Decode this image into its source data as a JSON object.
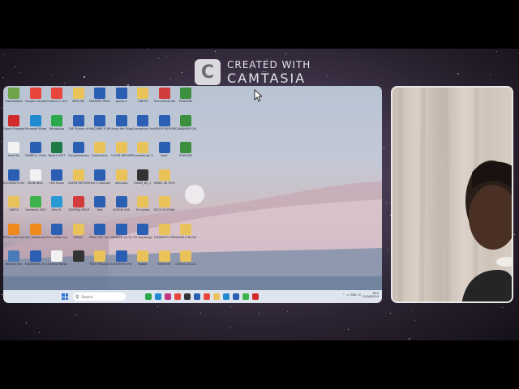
{
  "overlay": {
    "brand_line1": "CREATED WITH",
    "brand_line2": "CAMTASIA",
    "logo_letter": "C"
  },
  "desktop": {
    "icons": [
      {
        "label": "mandeladla",
        "color": "#6ea34a"
      },
      {
        "label": "Google Chrome",
        "color": "#e8453c"
      },
      {
        "label": "Chrome 2 Chrome",
        "color": "#e8453c"
      },
      {
        "label": "NEW 3B",
        "color": "#e9c25a"
      },
      {
        "label": "MISIMPO PROLI T",
        "color": "#2b5fb3"
      },
      {
        "label": "group 4",
        "color": "#2b5fb3"
      },
      {
        "label": "CNFSS",
        "color": "#e9c25a"
      },
      {
        "label": "Documents Methods",
        "color": "#d13b3b"
      },
      {
        "label": "PHAUNIE",
        "color": "#3c8f3c"
      },
      {
        "label": "Opera Browser",
        "color": "#d12a2a"
      },
      {
        "label": "Microsoft Edge",
        "color": "#1f8ad1"
      },
      {
        "label": "WhatsApp",
        "color": "#2aa84a"
      },
      {
        "label": "CNF Survey of a Studen",
        "color": "#2b5fb3"
      },
      {
        "label": "MACHINE FORMULA",
        "color": "#2b5fb3"
      },
      {
        "label": "Using the Diagnostic",
        "color": "#2b5fb3"
      },
      {
        "label": "Conceptual framework",
        "color": "#2b5fb3"
      },
      {
        "label": "KMSEP REPORT 1",
        "color": "#2b5fb3"
      },
      {
        "label": "CANAMAM DISHBOARD",
        "color": "#3c8f3c"
      },
      {
        "label": "text file",
        "color": "#f2f2f2"
      },
      {
        "label": "SUBBELL Cetex Hp",
        "color": "#2b5fb3"
      },
      {
        "label": "Book1.EDIT",
        "color": "#1e7b45"
      },
      {
        "label": "Comprehensive test",
        "color": "#2b5fb3"
      },
      {
        "label": "Collections",
        "color": "#e9c25a"
      },
      {
        "label": "CLEAR REPORT",
        "color": "#e9c25a"
      },
      {
        "label": "Proceedings Checklist",
        "color": "#e9c25a"
      },
      {
        "label": "tplet",
        "color": "#2b5fb3"
      },
      {
        "label": "PHAUNIE",
        "color": "#3c8f3c"
      },
      {
        "label": "ELEMENTS PAPERS",
        "color": "#2b5fb3"
      },
      {
        "label": "MAIN NEW",
        "color": "#f2f2f2"
      },
      {
        "label": "TED Exam",
        "color": "#2b5fb3"
      },
      {
        "label": "CNFSS REPORT",
        "color": "#e9c25a"
      },
      {
        "label": "Free 5 Operation",
        "color": "#2b5fb3"
      },
      {
        "label": "wmnosd",
        "color": "#e9c25a"
      },
      {
        "label": "EXSIR_BS_1",
        "color": "#333333"
      },
      {
        "label": "MENU 2B TEST CAMP 1",
        "color": "#e9c25a"
      },
      {
        "label": "CNFSS",
        "color": "#e9c25a"
      },
      {
        "label": "Camtasia 2023",
        "color": "#3bb24a"
      },
      {
        "label": "this PC",
        "color": "#2a9ad6"
      },
      {
        "label": "CENTRAL PROPOSAL",
        "color": "#d13b3b"
      },
      {
        "label": "Test",
        "color": "#2b5fb3"
      },
      {
        "label": "SOFEN VHS",
        "color": "#2b5fb3"
      },
      {
        "label": "Sri Lanka",
        "color": "#e9c25a"
      },
      {
        "label": "ECCS 2A FINAL MAP 1",
        "color": "#e9c25a"
      },
      {
        "label": "Philly Link Preview",
        "color": "#f08a1c"
      },
      {
        "label": "VLC media player",
        "color": "#f08a1c"
      },
      {
        "label": "The Coffee Code 3A",
        "color": "#2b5fb3"
      },
      {
        "label": "FAMILY",
        "color": "#e9c25a"
      },
      {
        "label": "PRACTICE 2A MOD 2",
        "color": "#2b5fb3"
      },
      {
        "label": "UNSEEN 1A SCR 3A",
        "color": "#2b5fb3"
      },
      {
        "label": "PH Sociology",
        "color": "#2b5fb3"
      },
      {
        "label": "ELEMENTS PEER CAMP",
        "color": "#e9c25a"
      },
      {
        "label": "ANGELS BOOKS",
        "color": "#e9c25a"
      },
      {
        "label": "Recycle Bin",
        "color": "#4a7bb8"
      },
      {
        "label": "ELEMENTS Hi Caps 2",
        "color": "#2b5fb3"
      },
      {
        "label": "Untitled Notes",
        "color": "#f2f2f2"
      },
      {
        "label": "",
        "color": "#333333"
      },
      {
        "label": "TEST MODULES",
        "color": "#e9c25a"
      },
      {
        "label": "ELEMENTS Personal",
        "color": "#2b5fb3"
      },
      {
        "label": "Rabbit",
        "color": "#e9c25a"
      },
      {
        "label": "PARENTS",
        "color": "#e9c25a"
      },
      {
        "label": "CNTCS COLLECTN",
        "color": "#e9c25a"
      }
    ]
  },
  "taskbar": {
    "search_placeholder": "Search",
    "apps": [
      "#2aa84a",
      "#1f8ad1",
      "#c13584",
      "#e8453c",
      "#333333",
      "#2b5fb3",
      "#e8453c",
      "#e9c25a",
      "#1f8ad1",
      "#2b5fb3",
      "#3bb24a",
      "#d12a2a"
    ],
    "tray_text": "ENG",
    "time": "16:2",
    "date": "01/09/2024"
  }
}
